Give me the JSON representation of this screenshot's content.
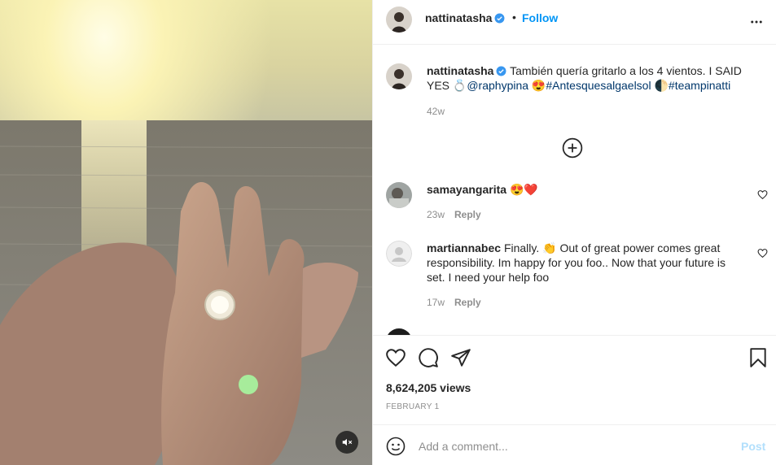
{
  "post": {
    "username": "nattinatasha",
    "separator": "•",
    "follow_label": "Follow",
    "colors": {
      "link": "#00376b",
      "follow": "#0095f6",
      "verified": "#3897f0"
    }
  },
  "caption": {
    "username": "nattinatasha",
    "text_before": "También quería gritarlo a los 4 vientos. I SAID YES ",
    "mention": "@raphypina",
    "hashtag1": "#Antesquesalgaelsol",
    "hashtag2": "#teampinatti",
    "time": "42w"
  },
  "comments": [
    {
      "username": "samayangarita",
      "text": "😍❤️",
      "time": "23w",
      "reply": "Reply"
    },
    {
      "username": "martiannabec",
      "text": "Finally. 👏 Out of great power comes great responsibility. Im happy for you foo.. Now that your future is set. I need your help foo",
      "time": "17w",
      "reply": "Reply"
    }
  ],
  "stats": {
    "views": "8,624,205 views",
    "date": "FEBRUARY 1"
  },
  "add_comment": {
    "placeholder": "Add a comment...",
    "post_label": "Post"
  },
  "icons": [
    "verified-badge-icon",
    "more-options-icon",
    "load-more-icon",
    "heart-icon",
    "comment-icon",
    "share-icon",
    "save-icon",
    "emoji-icon",
    "mute-icon"
  ]
}
